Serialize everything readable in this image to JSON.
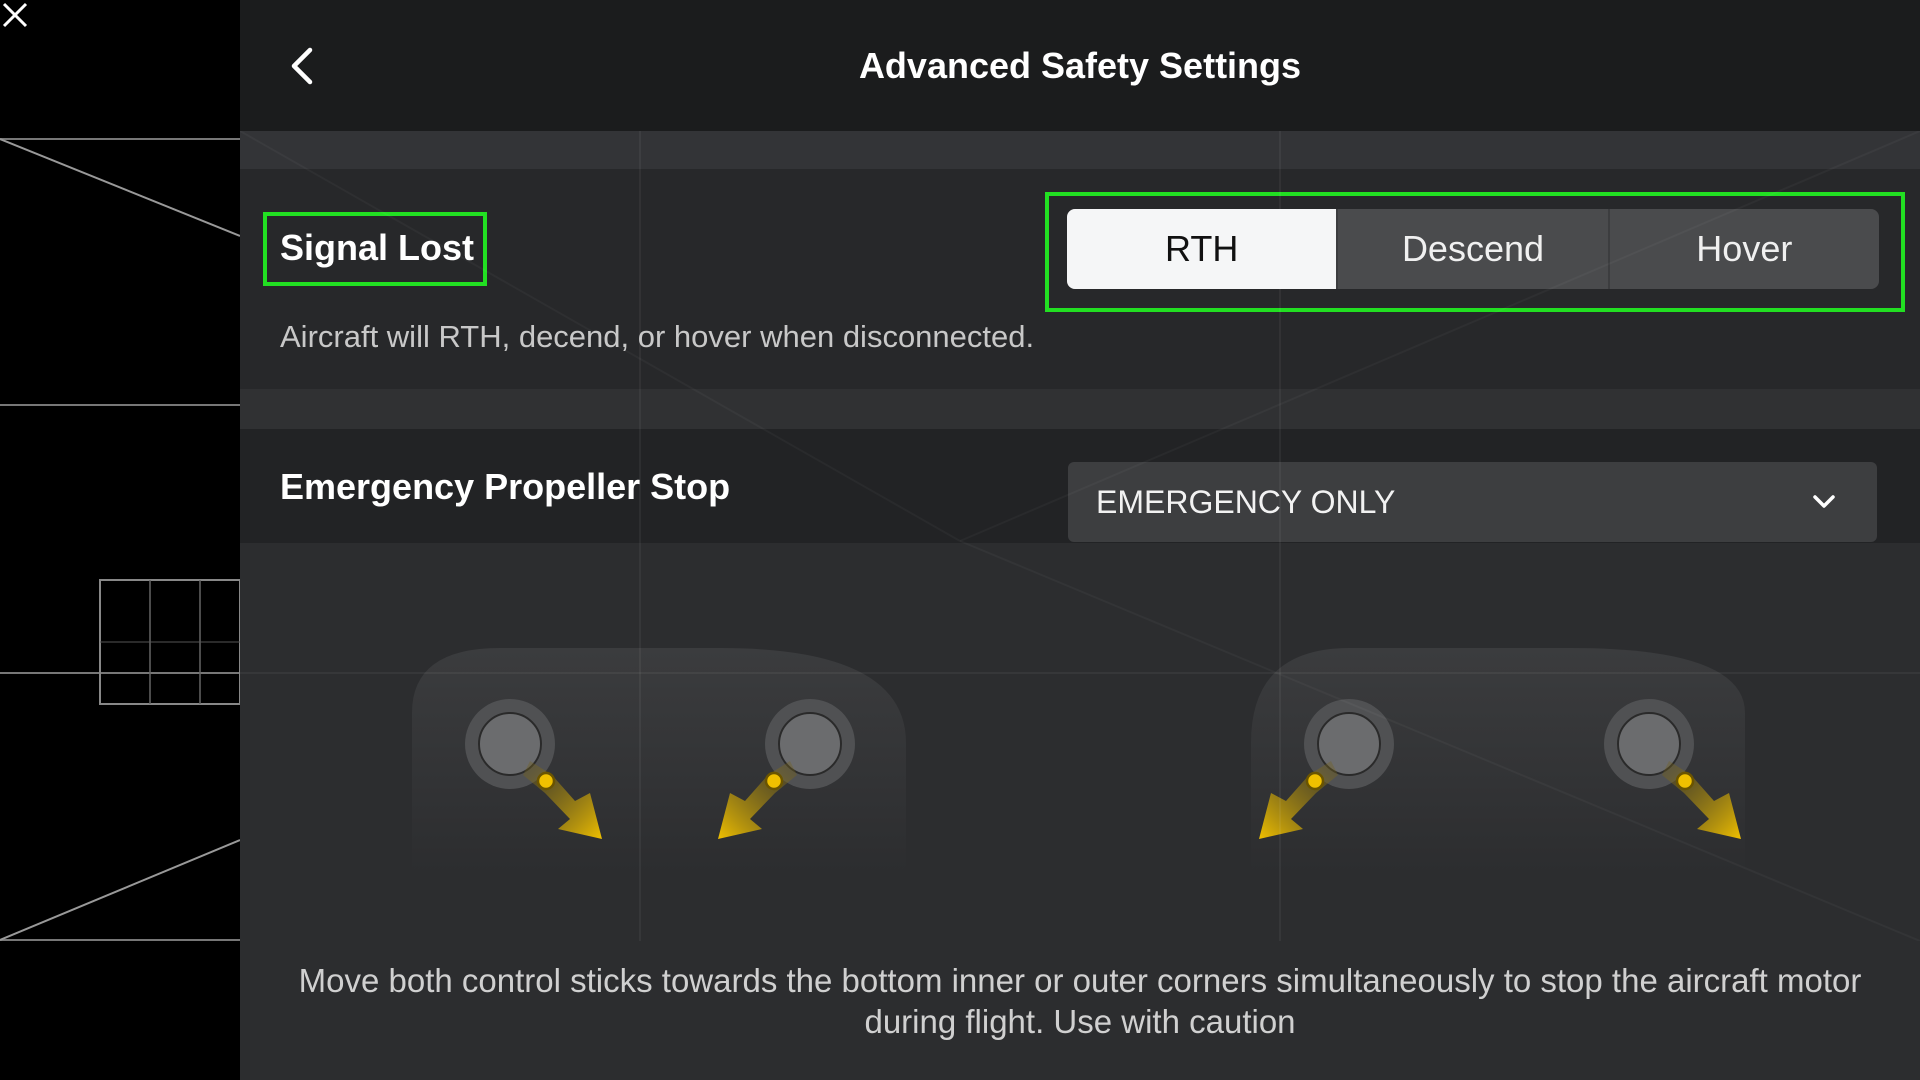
{
  "header": {
    "title": "Advanced Safety Settings",
    "back_icon": "chevron-left-icon"
  },
  "camera_strip": {
    "close_icon": "close-icon"
  },
  "signal_lost": {
    "label": "Signal Lost",
    "description": "Aircraft will RTH, decend, or hover when disconnected.",
    "options": [
      "RTH",
      "Descend",
      "Hover"
    ],
    "selected": "RTH",
    "highlight_color": "#22e022"
  },
  "emergency_propeller_stop": {
    "label": "Emergency Propeller Stop",
    "value": "EMERGENCY ONLY",
    "dropdown_icon": "chevron-down-icon"
  },
  "illustration": {
    "arrow_color": "#f0c000",
    "controllers": [
      "inner-corners",
      "outer-corners"
    ]
  },
  "footer": {
    "text": "Move both control sticks towards the bottom inner or outer corners simultaneously to stop the aircraft motor during flight. Use with caution"
  }
}
